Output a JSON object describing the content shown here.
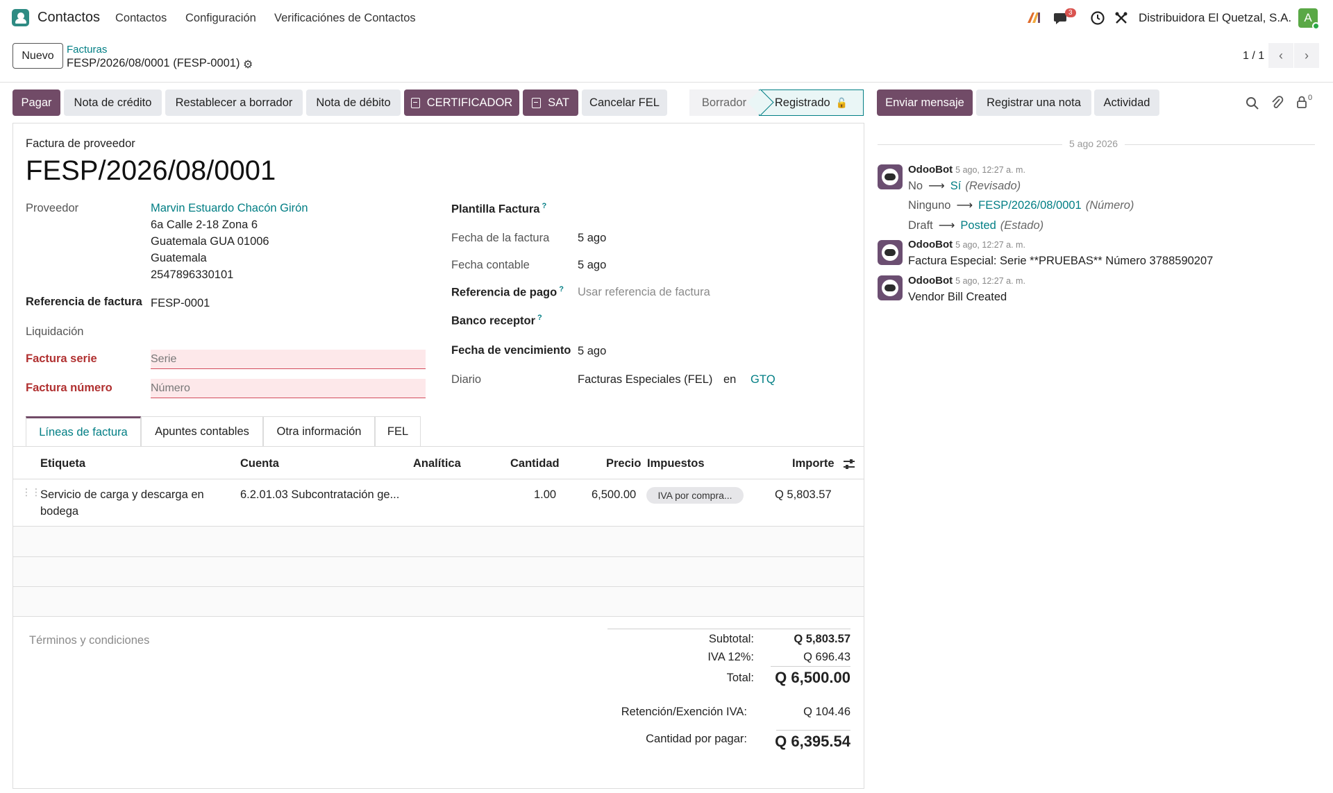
{
  "navbar": {
    "app_name": "Contactos",
    "menu": [
      "Contactos",
      "Configuración",
      "Verificaciónes de Contactos"
    ],
    "messages_badge": "3",
    "company": "Distribuidora El Quetzal, S.A.",
    "avatar_letter": "A"
  },
  "control_panel": {
    "new_label": "Nuevo",
    "breadcrumb_parent": "Facturas",
    "breadcrumb_current": "FESP/2026/08/0001 (FESP-0001)",
    "pager": "1 / 1"
  },
  "actions": {
    "pagar": "Pagar",
    "nota_credito": "Nota de crédito",
    "restablecer": "Restablecer a borrador",
    "nota_debito": "Nota de débito",
    "certificador": "CERTIFICADOR",
    "sat": "SAT",
    "cancelar_fel": "Cancelar FEL"
  },
  "status": {
    "borrador": "Borrador",
    "registrado": "Registrado"
  },
  "form": {
    "doc_type": "Factura de proveedor",
    "name": "FESP/2026/08/0001",
    "proveedor_label": "Proveedor",
    "proveedor_name": "Marvin Estuardo Chacón Girón",
    "address": [
      "6a Calle 2-18 Zona 6",
      "Guatemala GUA 01006",
      "Guatemala",
      "2547896330101"
    ],
    "ref_label": "Referencia de factura",
    "ref_value": "FESP-0001",
    "liquidacion_label": "Liquidación",
    "serie_label": "Factura serie",
    "serie_placeholder": "Serie",
    "numero_label": "Factura número",
    "numero_placeholder": "Número",
    "plantilla_label": "Plantilla Factura",
    "fecha_factura_label": "Fecha de la factura",
    "fecha_factura": "5 ago",
    "fecha_contable_label": "Fecha contable",
    "fecha_contable": "5 ago",
    "ref_pago_label": "Referencia de pago",
    "ref_pago_placeholder": "Usar referencia de factura",
    "banco_label": "Banco receptor",
    "vencimiento_label": "Fecha de vencimiento",
    "vencimiento": "5 ago",
    "diario_label": "Diario",
    "diario": "Facturas Especiales (FEL)",
    "en": "en",
    "currency": "GTQ",
    "help_mark": "?"
  },
  "tabs": [
    "Líneas de factura",
    "Apuntes contables",
    "Otra información",
    "FEL"
  ],
  "table": {
    "headers": [
      "Etiqueta",
      "Cuenta",
      "Analítica",
      "Cantidad",
      "Precio",
      "Impuestos",
      "Importe"
    ],
    "rows": [
      {
        "etiqueta_1": "Servicio de carga y descarga en",
        "etiqueta_2": "bodega",
        "cuenta": "6.2.01.03 Subcontratación ge...",
        "cantidad": "1.00",
        "precio": "6,500.00",
        "impuesto": "IVA por compra...",
        "importe": "Q 5,803.57"
      }
    ]
  },
  "terms_placeholder": "Términos y condiciones",
  "totals": {
    "subtotal_label": "Subtotal:",
    "subtotal": "Q 5,803.57",
    "iva_label": "IVA 12%:",
    "iva": "Q 696.43",
    "total_label": "Total:",
    "total": "Q 6,500.00",
    "retencion_label": "Retención/Exención IVA:",
    "retencion": "Q 104.46",
    "por_pagar_label": "Cantidad por pagar:",
    "por_pagar": "Q 6,395.54"
  },
  "chatter": {
    "send_message": "Enviar mensaje",
    "log_note": "Registrar una nota",
    "activity": "Actividad",
    "followers_count": "0",
    "date_separator": "5 ago 2026",
    "messages": [
      {
        "author": "OdooBot",
        "time": "5 ago, 12:27 a. m.",
        "changes": [
          {
            "old": "No",
            "new": "Sí",
            "field": "(Revisado)"
          },
          {
            "old": "Ninguno",
            "new": "FESP/2026/08/0001",
            "field": "(Número)"
          },
          {
            "old": "Draft",
            "new": "Posted",
            "field": "(Estado)"
          }
        ]
      },
      {
        "author": "OdooBot",
        "time": "5 ago, 12:27 a. m.",
        "body": "Factura Especial: Serie **PRUEBAS** Número 3788590207"
      },
      {
        "author": "OdooBot",
        "time": "5 ago, 12:27 a. m.",
        "body": "Vendor Bill Created"
      }
    ]
  },
  "colors": {
    "primary": "#714b67",
    "link": "#017e84",
    "invalid_bg": "#fde8ea"
  }
}
